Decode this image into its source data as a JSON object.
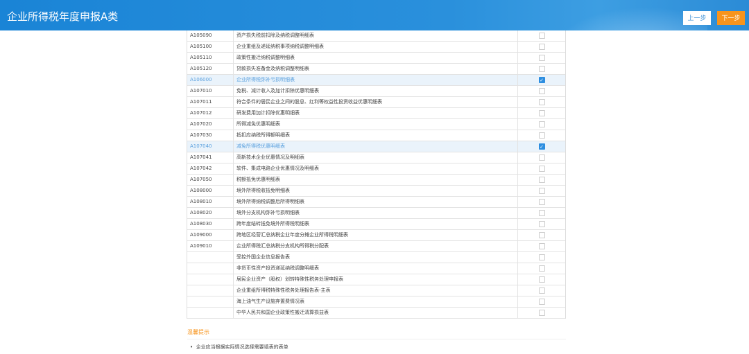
{
  "header": {
    "title": "企业所得税年度申报A类",
    "prev_label": "上一步",
    "next_label": "下一步"
  },
  "rows": [
    {
      "code": "A105090",
      "name": "资产损失税前扣除及纳税调整明细表",
      "checked": false
    },
    {
      "code": "A105100",
      "name": "企业重组及递延纳税事项纳税调整明细表",
      "checked": false
    },
    {
      "code": "A105110",
      "name": "政策性搬迁纳税调整明细表",
      "checked": false
    },
    {
      "code": "A105120",
      "name": "贷款损失准备金及纳税调整明细表",
      "checked": false
    },
    {
      "code": "A106000",
      "name": "企业所得税弥补亏损明细表",
      "checked": true
    },
    {
      "code": "A107010",
      "name": "免税、减计收入及加计扣除优惠明细表",
      "checked": false
    },
    {
      "code": "A107011",
      "name": "符合条件的居民企业之间的股息、红利等权益性投资收益优惠明细表",
      "checked": false
    },
    {
      "code": "A107012",
      "name": "研发费用加计扣除优惠明细表",
      "checked": false
    },
    {
      "code": "A107020",
      "name": "所得减免优惠明细表",
      "checked": false
    },
    {
      "code": "A107030",
      "name": "抵扣应纳税所得额明细表",
      "checked": false
    },
    {
      "code": "A107040",
      "name": "减免所得税优惠明细表",
      "checked": true
    },
    {
      "code": "A107041",
      "name": "高新技术企业优惠情况及明细表",
      "checked": false
    },
    {
      "code": "A107042",
      "name": "软件、集成电路企业优惠情况及明细表",
      "checked": false
    },
    {
      "code": "A107050",
      "name": "税额抵免优惠明细表",
      "checked": false
    },
    {
      "code": "A108000",
      "name": "境外所得税收抵免明细表",
      "checked": false
    },
    {
      "code": "A108010",
      "name": "境外所得纳税调整后所得明细表",
      "checked": false
    },
    {
      "code": "A108020",
      "name": "境外分支机构弥补亏损明细表",
      "checked": false
    },
    {
      "code": "A108030",
      "name": "跨年度结转抵免境外所得税明细表",
      "checked": false
    },
    {
      "code": "A109000",
      "name": "跨地区经营汇总纳税企业年度分摊企业所得税明细表",
      "checked": false
    },
    {
      "code": "A109010",
      "name": "企业所得税汇总纳税分支机构所得税分配表",
      "checked": false
    },
    {
      "code": "",
      "name": "受控外国企业信息报告表",
      "checked": false
    },
    {
      "code": "",
      "name": "非货币性资产投资递延纳税调整明细表",
      "checked": false
    },
    {
      "code": "",
      "name": "居民企业资产（股权）划转特殊性税务处理申报表",
      "checked": false
    },
    {
      "code": "",
      "name": "企业重组所得税特殊性税务处理报告表-主表",
      "checked": false
    },
    {
      "code": "",
      "name": "海上油气生产设施弃置费情况表",
      "checked": false
    },
    {
      "code": "",
      "name": "中华人民共和国企业政策性搬迁清算损益表",
      "checked": false
    }
  ],
  "tips": {
    "title": "温馨提示",
    "items": [
      "企业应当根据实际情况选择需要填表的表单"
    ]
  },
  "colors": {
    "header": "#1a84d6",
    "next": "#f7941d",
    "checked": "#2d8ee0"
  }
}
